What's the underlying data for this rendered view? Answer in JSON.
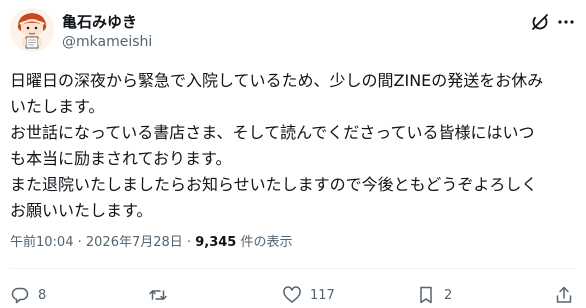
{
  "author": {
    "display_name": "亀石みゆき",
    "handle": "@mkameishi"
  },
  "post": {
    "lines": [
      "日曜日の深夜から緊急で入院しているため、少しの間ZINEの発送をお休み",
      "いたします。",
      "お世話になっている書店さま、そして読んでくださっている皆様にはいつ",
      "も本当に励まされております。",
      "また退院いたしましたらお知らせいたしますので今後ともどうぞよろしく",
      "お願いいたします。"
    ],
    "time": "午前10:04",
    "separator": "·",
    "date": "2026年7月28日",
    "views": "9,345",
    "views_label": "件の表示"
  },
  "actions": {
    "replies": "8",
    "reposts": "",
    "likes": "117",
    "bookmarks": "2"
  },
  "icons": {
    "grok": "grok-icon",
    "more": "more-icon",
    "reply": "reply-icon",
    "repost": "repost-icon",
    "like": "heart-icon",
    "bookmark": "bookmark-icon",
    "share": "share-icon"
  },
  "colors": {
    "text": "#0f1419",
    "secondary": "#536471",
    "divider": "#eff3f4"
  }
}
